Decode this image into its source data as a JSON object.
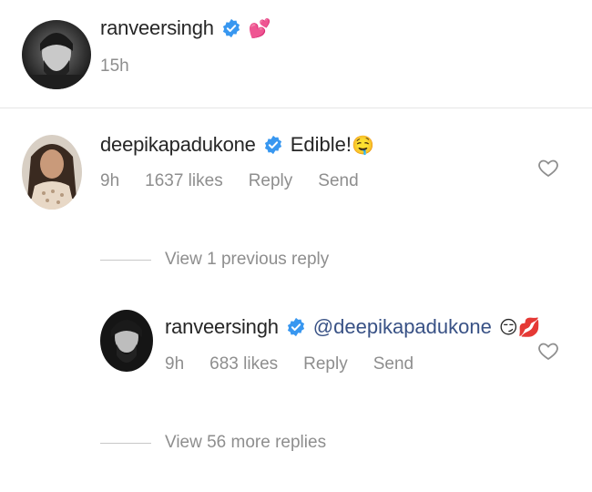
{
  "caption": {
    "username": "ranveersingh",
    "emoji": "💕",
    "time": "15h"
  },
  "comment": {
    "username": "deepikapadukone",
    "text": "Edible!",
    "emoji": "🤤",
    "time": "9h",
    "likes": "1637 likes",
    "reply_label": "Reply",
    "send_label": "Send"
  },
  "view_previous": "View 1 previous reply",
  "reply": {
    "username": "ranveersingh",
    "mention": "@deepikapadukone",
    "emoji": "😏💋",
    "time": "9h",
    "likes": "683 likes",
    "reply_label": "Reply",
    "send_label": "Send"
  },
  "view_more": "View 56 more replies",
  "colors": {
    "verified": "#3897f0",
    "mention": "#385185",
    "meta": "#8e8e8e"
  }
}
